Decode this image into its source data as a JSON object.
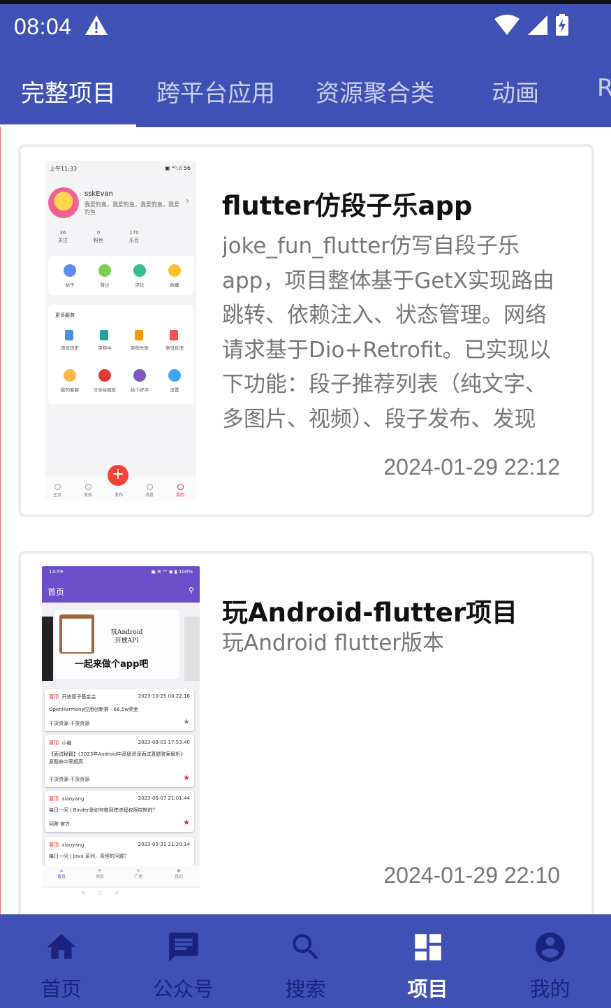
{
  "status_bar": {
    "time": "08:04"
  },
  "tabs": [
    {
      "label": "完整项目",
      "active": true
    },
    {
      "label": "跨平台应用",
      "active": false
    },
    {
      "label": "资源聚合类",
      "active": false
    },
    {
      "label": "动画",
      "active": false
    },
    {
      "label": "R",
      "active": false
    }
  ],
  "projects": [
    {
      "title": "flutter仿段子乐app",
      "desc": "joke_fun_flutter仿写自段子乐app，项目整体基于GetX实现路由跳转、依赖注入、状态管理。网络请求基于Dio+Retrofit。已实现以下功能：段子推荐列表（纯文字、多图片、视频）、段子发布、发现（综合或文字或",
      "date": "2024-01-29 22:12",
      "preview": {
        "status_time": "上午11:33",
        "status_right": "▣ ⁴ᴳ.ıl 56",
        "username": "sskEvan",
        "bio": "我爱钓鱼，我爱钓鱼，我爱钓鱼，我爱钓鱼",
        "stats": [
          {
            "value": "36",
            "label": "关注"
          },
          {
            "value": "0",
            "label": "粉丝"
          },
          {
            "value": "170",
            "label": "乐豆"
          }
        ],
        "shortcuts": [
          "帖子",
          "赞过",
          "评论",
          "收藏"
        ],
        "more_services_title": "更多服务",
        "services_row1": [
          "浏览历史",
          "审核中",
          "审核失败",
          "意见反馈"
        ],
        "services_row2": [
          "我的客服",
          "分享给朋友",
          "给个好评",
          "设置"
        ],
        "fab": "+",
        "nav": [
          "主页",
          "发现",
          "发布",
          "消息",
          "我的"
        ]
      }
    },
    {
      "title": "玩Android-flutter项目",
      "desc": "玩Android flutter版本",
      "date": "2024-01-29 22:10",
      "preview": {
        "status_time": "13:59",
        "status_right": "▣ ✻ ⁵ᴳ ◉ ▮ 100%",
        "page_title": "首页",
        "banner_line1": "玩Android",
        "banner_line2": "开放API",
        "banner_slogan": "一起来做个app吧",
        "items": [
          {
            "tag": "置顶",
            "author": "开放原子基金会",
            "date": "2023-10-25 00:22:16",
            "title": "OpenHarmony应用创新赛 - 66.5w奖金",
            "category": "干货资源·干货资源",
            "starred": false
          },
          {
            "tag": "置顶",
            "author": "小编",
            "date": "2023-08-03 17:53:40",
            "title": "【面试秘籍】《2023年Android中高级资深面试真题答案解析》原题命中率超高",
            "category": "干货资源·干货资源",
            "starred": true
          },
          {
            "tag": "置顶",
            "author": "xiaoyang",
            "date": "2023-06-07 21:01:44",
            "title": "每日一问 | Binder是如何做到跨进程权限控制的？",
            "category": "问答·官方",
            "starred": true
          },
          {
            "tag": "置顶",
            "author": "xiaoyang",
            "date": "2023-05-31 21:20:14",
            "title": "每日一问 | Java 系列，奇怪的问题？",
            "category": "",
            "starred": false
          }
        ],
        "nav": [
          "首页",
          "项目",
          "广场",
          "我的"
        ],
        "sys_nav": "≡        ○        ◁"
      }
    }
  ],
  "bottom_nav": [
    {
      "label": "首页",
      "icon": "home-icon",
      "active": false
    },
    {
      "label": "公众号",
      "icon": "chat-icon",
      "active": false
    },
    {
      "label": "搜索",
      "icon": "search-icon",
      "active": false
    },
    {
      "label": "项目",
      "icon": "dashboard-icon",
      "active": true
    },
    {
      "label": "我的",
      "icon": "account-icon",
      "active": false
    }
  ],
  "colors": {
    "primary": "#3f51b5",
    "nav_inactive": "#1a237e",
    "text_secondary": "#777777"
  }
}
